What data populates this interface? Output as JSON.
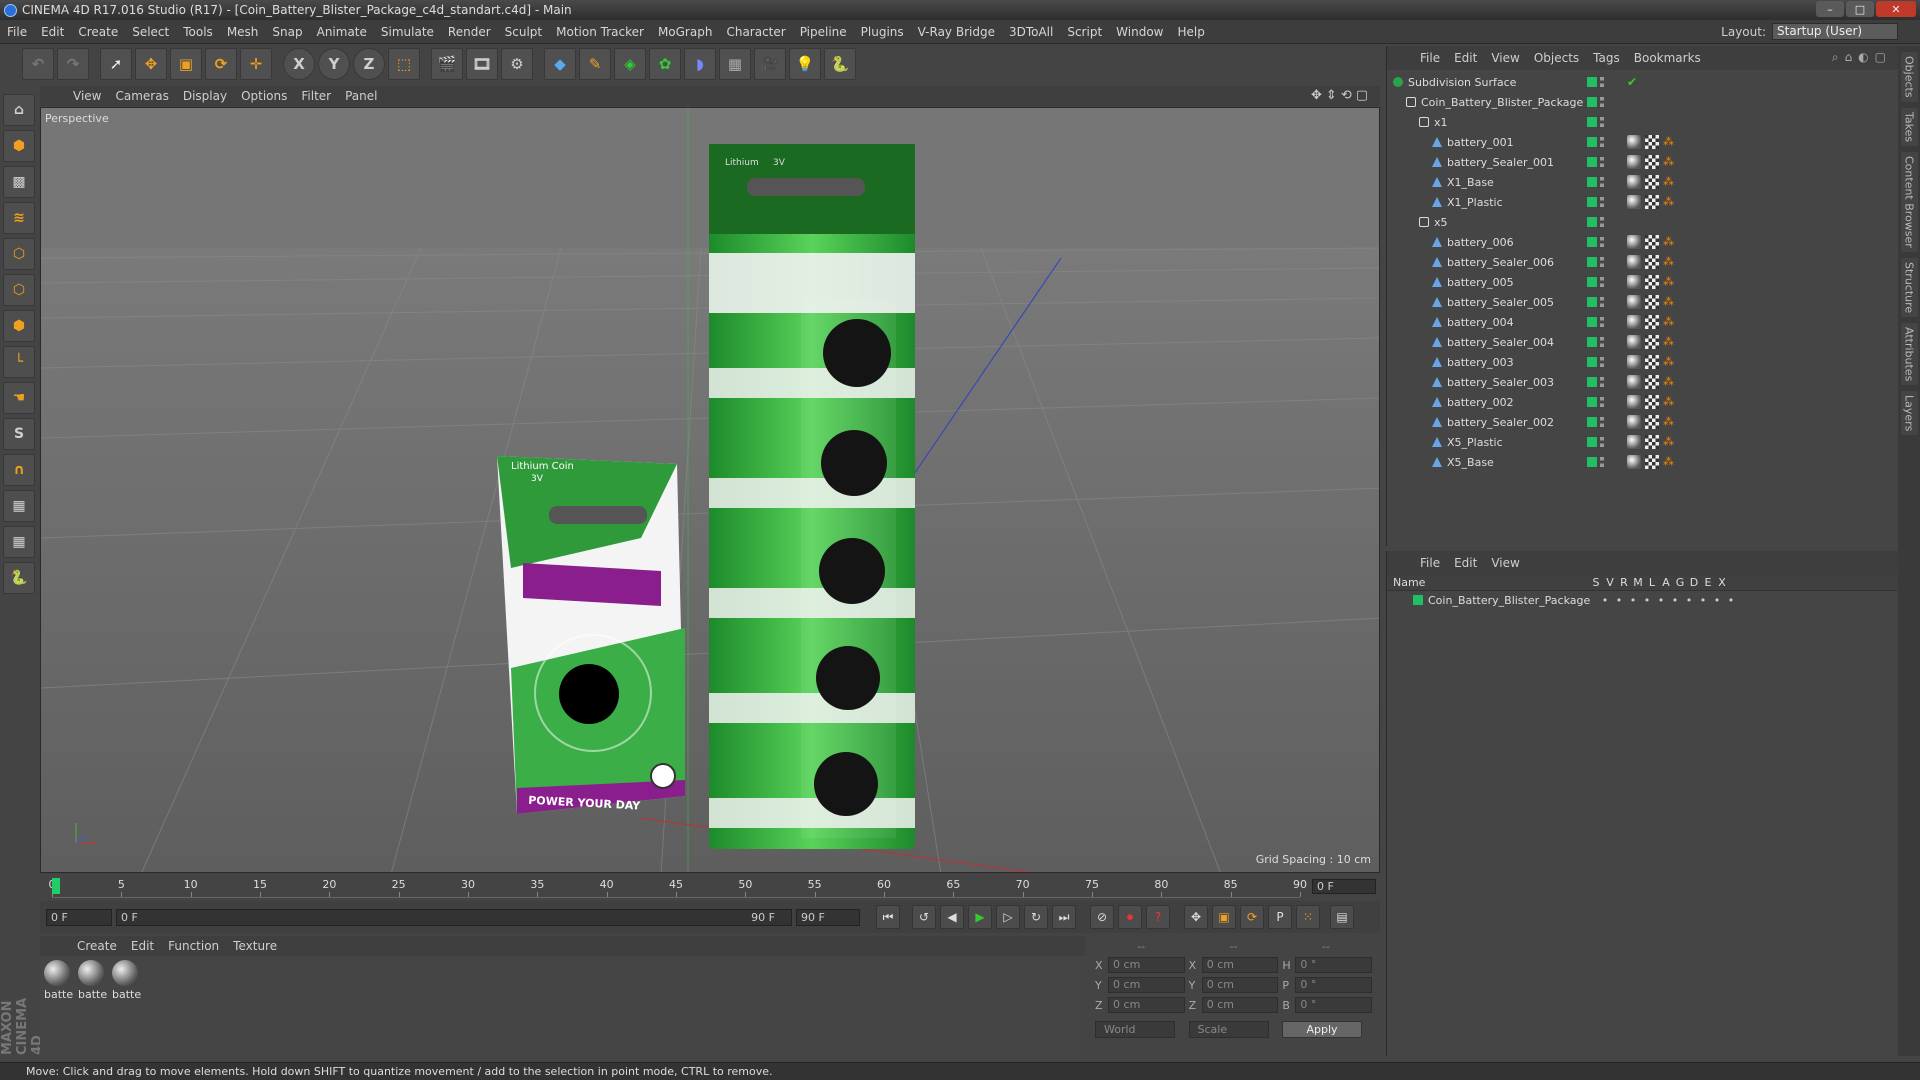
{
  "window": {
    "title": "CINEMA 4D R17.016 Studio (R17) - [Coin_Battery_Blister_Package_c4d_standart.c4d] - Main"
  },
  "menubar": [
    "File",
    "Edit",
    "Create",
    "Select",
    "Tools",
    "Mesh",
    "Snap",
    "Animate",
    "Simulate",
    "Render",
    "Sculpt",
    "Motion Tracker",
    "MoGraph",
    "Character",
    "Pipeline",
    "Plugins",
    "V-Ray Bridge",
    "3DToAll",
    "Script",
    "Window",
    "Help"
  ],
  "layout": {
    "label": "Layout:",
    "value": "Startup (User)"
  },
  "viewport": {
    "menu": [
      "View",
      "Cameras",
      "Display",
      "Options",
      "Filter",
      "Panel"
    ],
    "camera": "Perspective",
    "grid_spacing": "Grid Spacing : 10 cm",
    "package_small": {
      "brand": "Lithium Coin",
      "voltage": "3V",
      "slogan": "POWER YOUR DAY"
    },
    "package_tall": {
      "brand": "Lithium",
      "voltage": "3V"
    }
  },
  "timeline": {
    "ticks": [
      "0",
      "5",
      "10",
      "15",
      "20",
      "25",
      "30",
      "35",
      "40",
      "45",
      "50",
      "55",
      "60",
      "65",
      "70",
      "75",
      "80",
      "85",
      "90"
    ],
    "current_frame": "0 F",
    "start": "0 F",
    "range_start": "0 F",
    "range_end": "90 F",
    "end": "90 F"
  },
  "material_panel": {
    "menu": [
      "Create",
      "Edit",
      "Function",
      "Texture"
    ],
    "materials": [
      "batte",
      "batte",
      "batte"
    ]
  },
  "coords": {
    "headers": [
      "--",
      "--",
      "--"
    ],
    "rows": [
      {
        "a": "X",
        "av": "0 cm",
        "b": "X",
        "bv": "0 cm",
        "c": "H",
        "cv": "0 °"
      },
      {
        "a": "Y",
        "av": "0 cm",
        "b": "Y",
        "bv": "0 cm",
        "c": "P",
        "cv": "0 °"
      },
      {
        "a": "Z",
        "av": "0 cm",
        "b": "Z",
        "bv": "0 cm",
        "c": "B",
        "cv": "0 °"
      }
    ],
    "space": "World",
    "mode": "Scale",
    "apply": "Apply"
  },
  "object_manager": {
    "menu": [
      "File",
      "Edit",
      "View",
      "Objects",
      "Tags",
      "Bookmarks"
    ],
    "objects": [
      {
        "name": "Subdivision Surface",
        "indent": 0,
        "icon": "sub",
        "tags": ""
      },
      {
        "name": "Coin_Battery_Blister_Package",
        "indent": 1,
        "icon": "null",
        "tags": ""
      },
      {
        "name": "x1",
        "indent": 2,
        "icon": "null",
        "tags": ""
      },
      {
        "name": "battery_001",
        "indent": 3,
        "icon": "poly",
        "tags": "mco"
      },
      {
        "name": "battery_Sealer_001",
        "indent": 3,
        "icon": "poly",
        "tags": "mco"
      },
      {
        "name": "X1_Base",
        "indent": 3,
        "icon": "poly",
        "tags": "mco"
      },
      {
        "name": "X1_Plastic",
        "indent": 3,
        "icon": "poly",
        "tags": "mco"
      },
      {
        "name": "x5",
        "indent": 2,
        "icon": "null",
        "tags": ""
      },
      {
        "name": "battery_006",
        "indent": 3,
        "icon": "poly",
        "tags": "mco"
      },
      {
        "name": "battery_Sealer_006",
        "indent": 3,
        "icon": "poly",
        "tags": "mco"
      },
      {
        "name": "battery_005",
        "indent": 3,
        "icon": "poly",
        "tags": "mco"
      },
      {
        "name": "battery_Sealer_005",
        "indent": 3,
        "icon": "poly",
        "tags": "mco"
      },
      {
        "name": "battery_004",
        "indent": 3,
        "icon": "poly",
        "tags": "mco"
      },
      {
        "name": "battery_Sealer_004",
        "indent": 3,
        "icon": "poly",
        "tags": "mco"
      },
      {
        "name": "battery_003",
        "indent": 3,
        "icon": "poly",
        "tags": "mco"
      },
      {
        "name": "battery_Sealer_003",
        "indent": 3,
        "icon": "poly",
        "tags": "mco"
      },
      {
        "name": "battery_002",
        "indent": 3,
        "icon": "poly",
        "tags": "mco"
      },
      {
        "name": "battery_Sealer_002",
        "indent": 3,
        "icon": "poly",
        "tags": "mco"
      },
      {
        "name": "X5_Plastic",
        "indent": 3,
        "icon": "poly",
        "tags": "mco"
      },
      {
        "name": "X5_Base",
        "indent": 3,
        "icon": "poly",
        "tags": "mco"
      }
    ]
  },
  "layer_manager": {
    "menu": [
      "File",
      "Edit",
      "View"
    ],
    "header": {
      "name": "Name",
      "cols": [
        "S",
        "V",
        "R",
        "M",
        "L",
        "A",
        "G",
        "D",
        "E",
        "X"
      ]
    },
    "layers": [
      {
        "name": "Coin_Battery_Blister_Package",
        "color": "#22c066"
      }
    ]
  },
  "right_tabs": [
    "Objects",
    "Takes",
    "Content Browser",
    "Structure",
    "Attributes",
    "Layers"
  ],
  "statusbar": "Move: Click and drag to move elements. Hold down SHIFT to quantize movement / add to the selection in point mode, CTRL to remove.",
  "colors": {
    "accent_green": "#22c066",
    "viewport_bg": "#6b6b6b",
    "package_green": "#3aa84a",
    "package_purple": "#8a1e8c"
  }
}
